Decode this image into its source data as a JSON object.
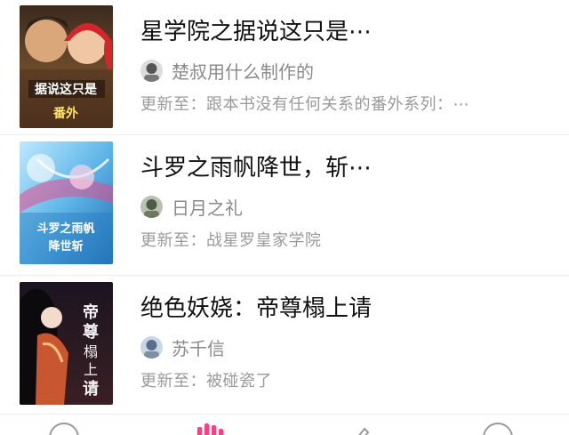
{
  "books": [
    {
      "title": "星学院之据说这只是⋯",
      "author": "楚叔用什么制作的",
      "update_prefix": "更新至：",
      "update_text": "跟本书没有任何关系的番外系列：⋯",
      "cover_caption": "据说这只是番外"
    },
    {
      "title": "斗罗之雨帆降世，斩⋯",
      "author": "日月之礼",
      "update_prefix": "更新至：",
      "update_text": "战星罗皇家学院",
      "cover_caption": "斗罗之雨帆降世斩"
    },
    {
      "title": "绝色妖娆：帝尊榻上请",
      "author": "苏千信",
      "update_prefix": "更新至：",
      "update_text": "被碰瓷了",
      "cover_caption": "帝尊榻上请"
    }
  ],
  "tabbar": {
    "tabs": [
      {
        "icon": "home-icon",
        "active": false
      },
      {
        "icon": "bookshelf-icon",
        "active": true
      },
      {
        "icon": "write-icon",
        "active": false
      },
      {
        "icon": "profile-icon",
        "active": false
      }
    ],
    "accent": "#ff3e7f"
  }
}
